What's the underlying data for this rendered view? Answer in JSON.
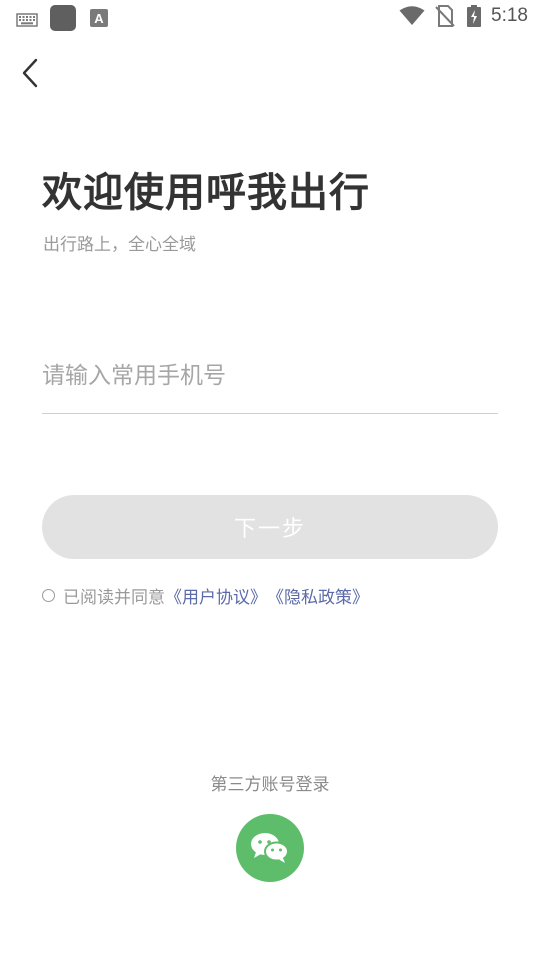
{
  "status_bar": {
    "time": "5:18",
    "left_icons": [
      "keyboard-icon",
      "app-icon",
      "a11y-text-icon"
    ],
    "right_icons": [
      "wifi-icon",
      "no-sim-icon",
      "battery-charging-icon"
    ]
  },
  "nav": {
    "back_icon": "chevron-left-icon"
  },
  "header": {
    "title": "欢迎使用呼我出行",
    "subtitle": "出行路上，全心全域"
  },
  "phone": {
    "placeholder": "请输入常用手机号",
    "value": ""
  },
  "actions": {
    "next_label": "下一步"
  },
  "agreement": {
    "checked": false,
    "prefix": "已阅读并同意",
    "user_agreement": "《用户协议》",
    "privacy_policy": "《隐私政策》"
  },
  "third_party": {
    "title": "第三方账号登录",
    "wechat_icon": "wechat-icon"
  },
  "colors": {
    "title_text": "#333333",
    "muted_text": "#9a9a9a",
    "link": "#5b6aa8",
    "button_disabled_bg": "#e2e2e2",
    "wechat_green": "#5ebd6a"
  }
}
